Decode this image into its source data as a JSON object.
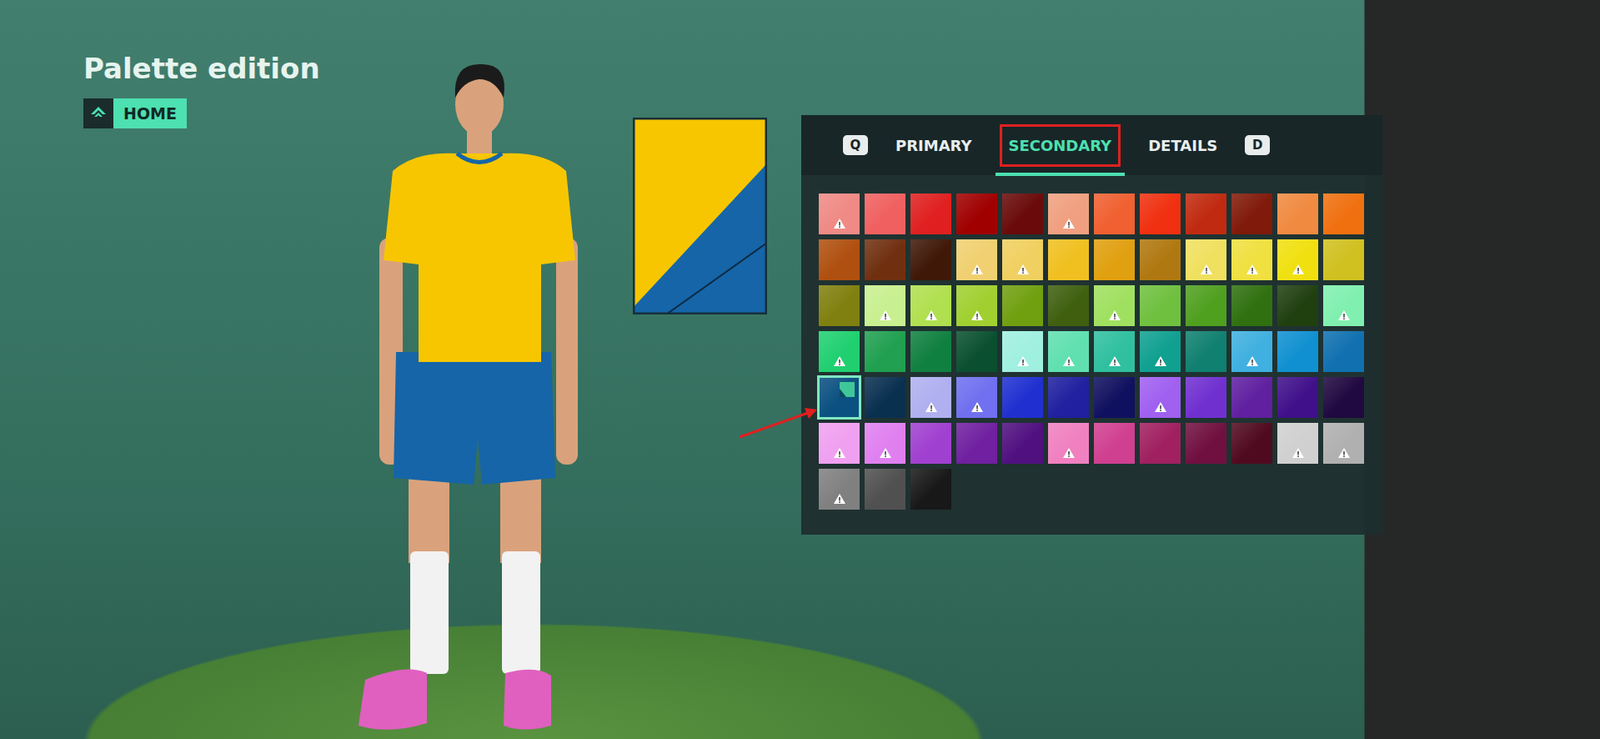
{
  "screen": {
    "title": "Palette edition",
    "badge": "HOME"
  },
  "preview": {
    "primary": "#f7c600",
    "secondary": "#1565a8"
  },
  "tabs": [
    {
      "key": "Q",
      "label": "PRIMARY",
      "selected": false,
      "annotated": false
    },
    {
      "key": "",
      "label": "SECONDARY",
      "selected": true,
      "annotated": true
    },
    {
      "key": "D",
      "label": "DETAILS",
      "selected": false,
      "annotated": false
    }
  ],
  "annotations": {
    "arrow_to_selected": true
  },
  "palette": [
    {
      "color": "#f08a85",
      "warning": true,
      "selected": false
    },
    {
      "color": "#f06060",
      "warning": false,
      "selected": false
    },
    {
      "color": "#e02020",
      "warning": false,
      "selected": false
    },
    {
      "color": "#a00000",
      "warning": false,
      "selected": false
    },
    {
      "color": "#6a0a0a",
      "warning": false,
      "selected": false
    },
    {
      "color": "#f0a080",
      "warning": true,
      "selected": false
    },
    {
      "color": "#f06030",
      "warning": false,
      "selected": false
    },
    {
      "color": "#f03010",
      "warning": false,
      "selected": false
    },
    {
      "color": "#c02a10",
      "warning": false,
      "selected": false
    },
    {
      "color": "#801a0a",
      "warning": false,
      "selected": false
    },
    {
      "color": "#f08a40",
      "warning": false,
      "selected": false
    },
    {
      "color": "#f07010",
      "warning": false,
      "selected": false
    },
    {
      "color": "#b05010",
      "warning": false,
      "selected": false
    },
    {
      "color": "#703010",
      "warning": false,
      "selected": false
    },
    {
      "color": "#401808",
      "warning": false,
      "selected": false
    },
    {
      "color": "#f0d070",
      "warning": true,
      "selected": false
    },
    {
      "color": "#f0d060",
      "warning": true,
      "selected": false
    },
    {
      "color": "#f0c020",
      "warning": false,
      "selected": false
    },
    {
      "color": "#e0a010",
      "warning": false,
      "selected": false
    },
    {
      "color": "#b07810",
      "warning": false,
      "selected": false
    },
    {
      "color": "#f0e060",
      "warning": true,
      "selected": false
    },
    {
      "color": "#f0e040",
      "warning": true,
      "selected": false
    },
    {
      "color": "#f0e010",
      "warning": true,
      "selected": false
    },
    {
      "color": "#d0c020",
      "warning": false,
      "selected": false
    },
    {
      "color": "#808010",
      "warning": false,
      "selected": false
    },
    {
      "color": "#c8f090",
      "warning": true,
      "selected": false
    },
    {
      "color": "#b0e050",
      "warning": true,
      "selected": false
    },
    {
      "color": "#a0d030",
      "warning": true,
      "selected": false
    },
    {
      "color": "#70a010",
      "warning": false,
      "selected": false
    },
    {
      "color": "#406010",
      "warning": false,
      "selected": false
    },
    {
      "color": "#a0e060",
      "warning": true,
      "selected": false
    },
    {
      "color": "#70c040",
      "warning": false,
      "selected": false
    },
    {
      "color": "#50a020",
      "warning": false,
      "selected": false
    },
    {
      "color": "#307010",
      "warning": false,
      "selected": false
    },
    {
      "color": "#204010",
      "warning": false,
      "selected": false
    },
    {
      "color": "#80f0b0",
      "warning": true,
      "selected": false
    },
    {
      "color": "#20d070",
      "warning": true,
      "selected": false
    },
    {
      "color": "#20a050",
      "warning": false,
      "selected": false
    },
    {
      "color": "#108040",
      "warning": false,
      "selected": false
    },
    {
      "color": "#0a5030",
      "warning": false,
      "selected": false
    },
    {
      "color": "#a0f0e0",
      "warning": true,
      "selected": false
    },
    {
      "color": "#60e0b0",
      "warning": true,
      "selected": false
    },
    {
      "color": "#30c0a0",
      "warning": true,
      "selected": false
    },
    {
      "color": "#10a090",
      "warning": true,
      "selected": false
    },
    {
      "color": "#108070",
      "warning": false,
      "selected": false
    },
    {
      "color": "#40b0e0",
      "warning": true,
      "selected": false
    },
    {
      "color": "#1090d0",
      "warning": false,
      "selected": false
    },
    {
      "color": "#1070b0",
      "warning": false,
      "selected": false
    },
    {
      "color": "#0a5080",
      "warning": false,
      "selected": true
    },
    {
      "color": "#0a3050",
      "warning": false,
      "selected": false
    },
    {
      "color": "#b0b0f0",
      "warning": true,
      "selected": false
    },
    {
      "color": "#7070f0",
      "warning": true,
      "selected": false
    },
    {
      "color": "#2030d0",
      "warning": false,
      "selected": false
    },
    {
      "color": "#2020a0",
      "warning": false,
      "selected": false
    },
    {
      "color": "#101060",
      "warning": false,
      "selected": false
    },
    {
      "color": "#a060f0",
      "warning": true,
      "selected": false
    },
    {
      "color": "#7030d0",
      "warning": false,
      "selected": false
    },
    {
      "color": "#6020a0",
      "warning": false,
      "selected": false
    },
    {
      "color": "#40108a",
      "warning": false,
      "selected": false
    },
    {
      "color": "#200840",
      "warning": false,
      "selected": false
    },
    {
      "color": "#f0a0f0",
      "warning": true,
      "selected": false
    },
    {
      "color": "#e080f0",
      "warning": true,
      "selected": false
    },
    {
      "color": "#a040d0",
      "warning": false,
      "selected": false
    },
    {
      "color": "#7020a0",
      "warning": false,
      "selected": false
    },
    {
      "color": "#501080",
      "warning": false,
      "selected": false
    },
    {
      "color": "#f080c0",
      "warning": true,
      "selected": false
    },
    {
      "color": "#d04090",
      "warning": false,
      "selected": false
    },
    {
      "color": "#a02060",
      "warning": false,
      "selected": false
    },
    {
      "color": "#701040",
      "warning": false,
      "selected": false
    },
    {
      "color": "#500a20",
      "warning": false,
      "selected": false
    },
    {
      "color": "#d0d0d0",
      "warning": true,
      "selected": false
    },
    {
      "color": "#b0b0b0",
      "warning": true,
      "selected": false
    },
    {
      "color": "#808080",
      "warning": true,
      "selected": false
    },
    {
      "color": "#505050",
      "warning": false,
      "selected": false
    },
    {
      "color": "#181818",
      "warning": false,
      "selected": false
    }
  ]
}
